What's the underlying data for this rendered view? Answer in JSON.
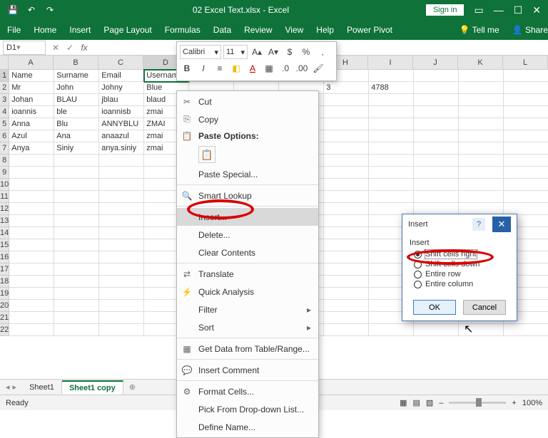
{
  "title": "02 Excel Text.xlsx - Excel",
  "signin": "Sign in",
  "ribbon": [
    "File",
    "Home",
    "Insert",
    "Page Layout",
    "Formulas",
    "Data",
    "Review",
    "View",
    "Help",
    "Power Pivot"
  ],
  "tellme": "Tell me",
  "share": "Share",
  "namebox": "D1",
  "columns": [
    "A",
    "B",
    "C",
    "D",
    "E",
    "F",
    "G",
    "H",
    "I",
    "J",
    "K",
    "L"
  ],
  "sel_col": "D",
  "rows": 22,
  "sel_row": 1,
  "data": [
    [
      "Name",
      "Surname",
      "Email",
      "Username",
      "",
      "",
      "",
      "",
      "",
      "",
      "",
      ""
    ],
    [
      "Mr",
      "John",
      "Johny",
      "Blue",
      "",
      "",
      "",
      "3",
      "4788",
      "",
      "",
      ""
    ],
    [
      "Johan",
      "BLAU",
      "jblau",
      "blaud",
      "",
      "",
      "",
      "",
      "",
      "",
      "",
      ""
    ],
    [
      "ioannis",
      "ble",
      "ioannisb",
      "zmai",
      "",
      "",
      "",
      "",
      "",
      "",
      "",
      ""
    ],
    [
      "Anna",
      "Blu",
      "ANNYBLU",
      "ZMAI",
      "",
      "",
      "",
      "",
      "",
      "",
      "",
      ""
    ],
    [
      "Azul",
      "Ana",
      "anaazul",
      "zmai",
      "",
      "",
      "",
      "",
      "",
      "",
      "",
      ""
    ],
    [
      "Anya",
      "Siniy",
      "anya.siniy",
      "zmai",
      "",
      "",
      "",
      "",
      "",
      "",
      "",
      ""
    ]
  ],
  "sheets": [
    "Sheet1",
    "Sheet1 copy"
  ],
  "active_sheet": 1,
  "status": "Ready",
  "zoom": "100%",
  "minitb": {
    "font": "Calibri",
    "size": "11"
  },
  "ctx": {
    "cut": "Cut",
    "copy": "Copy",
    "paste_opts": "Paste Options:",
    "paste_special": "Paste Special...",
    "smart": "Smart Lookup",
    "insert": "Insert...",
    "delete": "Delete...",
    "clear": "Clear Contents",
    "translate": "Translate",
    "quick": "Quick Analysis",
    "filter": "Filter",
    "sort": "Sort",
    "getdata": "Get Data from Table/Range...",
    "comment": "Insert Comment",
    "format": "Format Cells...",
    "pick": "Pick From Drop-down List...",
    "define": "Define Name..."
  },
  "dlg": {
    "title": "Insert",
    "group": "Insert",
    "opt1": "Shift cells right",
    "opt2": "Shift cells down",
    "opt3": "Entire row",
    "opt4": "Entire column",
    "ok": "OK",
    "cancel": "Cancel"
  }
}
